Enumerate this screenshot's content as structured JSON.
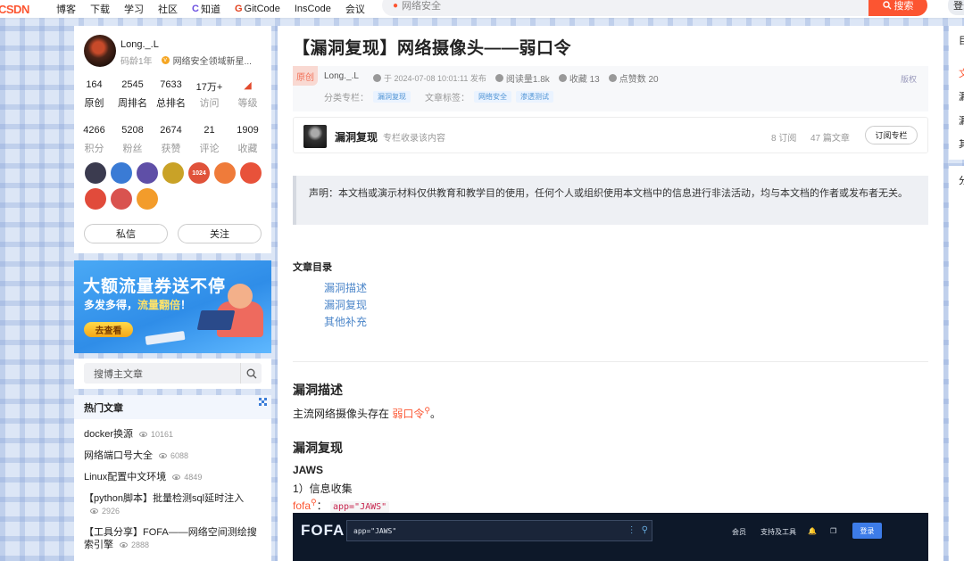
{
  "topbar": {
    "logo": "CSDN",
    "nav": [
      "博客",
      "下载",
      "学习",
      "社区",
      "知道",
      "GitCode",
      "InsCode",
      "会议"
    ],
    "search_placeholder": "网络安全",
    "search_button": "搜索",
    "login": "登录"
  },
  "profile": {
    "name": "Long._.L",
    "code_age": "码龄1年",
    "domain": "网络安全领域新星...",
    "stats_row1": [
      {
        "value": "164",
        "label": "原创"
      },
      {
        "value": "2545",
        "label": "周排名"
      },
      {
        "value": "7633",
        "label": "总排名"
      },
      {
        "value": "17万+",
        "label": "访问"
      },
      {
        "value": "",
        "label": "等级"
      }
    ],
    "stats_row2": [
      {
        "value": "4266",
        "label": "积分"
      },
      {
        "value": "5208",
        "label": "粉丝"
      },
      {
        "value": "2674",
        "label": "获赞"
      },
      {
        "value": "21",
        "label": "评论"
      },
      {
        "value": "1909",
        "label": "收藏"
      }
    ],
    "badges": [
      {
        "icon": "badge-hacker-icon",
        "text": "",
        "color": "#3b3b4f"
      },
      {
        "icon": "badge-blue-icon",
        "text": "",
        "color": "#3a7bd5"
      },
      {
        "icon": "badge-purple-icon",
        "text": "",
        "color": "#5f4fa7"
      },
      {
        "icon": "badge-gold-icon",
        "text": "",
        "color": "#c9a227"
      },
      {
        "icon": "badge-1024-icon",
        "text": "1024",
        "color": "#e0523a"
      },
      {
        "icon": "badge-orange-icon",
        "text": "",
        "color": "#ef7b3a"
      },
      {
        "icon": "badge-red-icon",
        "text": "",
        "color": "#e8523a"
      },
      {
        "icon": "badge-pen-icon",
        "text": "",
        "color": "#e14b3b"
      },
      {
        "icon": "badge-monkey-icon",
        "text": "",
        "color": "#d9534f"
      },
      {
        "icon": "badge-star-icon",
        "text": "",
        "color": "#f39c2b"
      }
    ],
    "message_button": "私信",
    "follow_button": "关注"
  },
  "ad": {
    "title": "大额流量券送不停",
    "subtitle_pre": "多发多得，",
    "subtitle_hl": "流量翻倍",
    "subtitle_post": "！",
    "cta": "去查看"
  },
  "side_search": {
    "placeholder": "搜博主文章"
  },
  "hot": {
    "title": "热门文章",
    "items": [
      {
        "title": "docker换源",
        "views": "10161"
      },
      {
        "title": "网络端口号大全",
        "views": "6088"
      },
      {
        "title": "Linux配置中文环境",
        "views": "4849"
      },
      {
        "title": "【python脚本】批量检测sql延时注入",
        "views": "2926"
      },
      {
        "title": "【工具分享】FOFA——网络空间测绘搜索引擎",
        "views": "2888"
      }
    ]
  },
  "article": {
    "title": "【漏洞复现】网络摄像头——弱口令",
    "original": "原创",
    "author": "Long._.L",
    "publish": "于 2024-07-08 10:01:11 发布",
    "read": "阅读量1.8k",
    "fav": "收藏 13",
    "likes": "点赞数 20",
    "copyright": "版权",
    "column_label": "分类专栏：",
    "column_tag": "漏洞复现",
    "tags_label": "文章标签：",
    "tags": [
      "网络安全",
      "渗透测试"
    ],
    "column": {
      "name": "漏洞复现",
      "desc": "专栏收录该内容",
      "subs": "8 订阅",
      "articles": "47 篇文章",
      "subscribe": "订阅专栏"
    },
    "notice": "声明：本文档或演示材料仅供教育和教学目的使用，任何个人或组织使用本文档中的信息进行非法活动，均与本文档的作者或发布者无关。",
    "toc_title": "文章目录",
    "toc": [
      "漏洞描述",
      "漏洞复现",
      "其他补充"
    ],
    "h_desc": "漏洞描述",
    "desc_pre": "主流网络摄像头存在",
    "desc_kw": "弱口令",
    "desc_post": "。",
    "h_repro": "漏洞复现",
    "h3_jaws": "JAWS",
    "step1": "1）信息收集",
    "fofa_kw": "fofa",
    "fofa_colon": "：",
    "fofa_query": "app=\"JAWS\""
  },
  "fofa_shot": {
    "logo": "FOFA",
    "query": "app=\"JAWS\"",
    "nav1": "会员",
    "nav2": "支持及工具",
    "login": "登录"
  },
  "right_panel": {
    "letters": [
      "目",
      "文",
      "漏",
      "漏",
      "其",
      "分"
    ]
  }
}
